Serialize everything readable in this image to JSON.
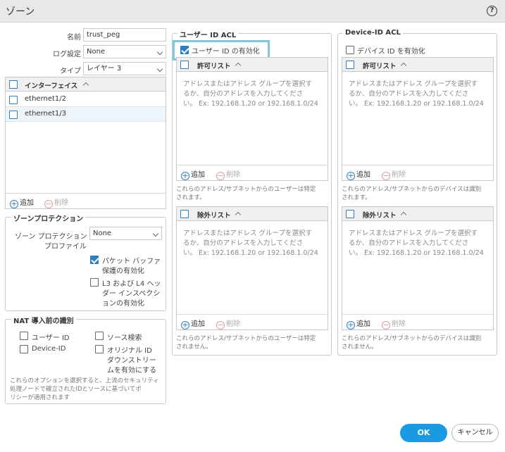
{
  "dialog": {
    "title": "ゾーン",
    "help": "?"
  },
  "form": {
    "name_label": "名前",
    "name_value": "trust_peg",
    "log_label": "ログ設定",
    "log_value": "None",
    "type_label": "タイプ",
    "type_value": "レイヤー 3"
  },
  "interfaces": {
    "header": "インターフェイス",
    "rows": [
      "ethernet1/2",
      "ethernet1/3"
    ],
    "add": "追加",
    "delete": "削除"
  },
  "zone_protection": {
    "legend": "ゾーンプロテクション",
    "profile_label_1": "ゾーン プロテクション",
    "profile_label_2": "プロファイル",
    "profile_value": "None",
    "packet_buffer_1": "パケット バッファ",
    "packet_buffer_2": "保護の有効化",
    "l3l4_1": "L3 および L4 ヘッ",
    "l3l4_2": "ダー インスペクシ",
    "l3l4_3": "ョンの有効化"
  },
  "nat": {
    "legend": "NAT 導入前の識別",
    "user_id": "ユーザー ID",
    "source_lookup": "ソース検索",
    "device_id": "Device-ID",
    "orig_id_1": "オリジナル ID",
    "orig_id_2": "ダウンストリー",
    "orig_id_3": "ムを有効にする",
    "note_1": "これらのオプションを選択すると、上流のセキュリティ",
    "note_2": "処理ノードで確立されたIDとソースに基づいてポ",
    "note_3": "リシーが適用されます"
  },
  "user_acl": {
    "legend": "ユーザー ID ACL",
    "enable": "ユーザー ID の有効化",
    "include_header": "許可リスト",
    "include_placeholder_1": "アドレスまたはアドレス グループを選択す",
    "include_placeholder_2": "るか、自分のアドレスを入力してくださ",
    "include_placeholder_3": "い。 Ex: 192.168.1.20 or 192.168.1.0/24",
    "include_note_1": "これらのアドレス/サブネットからのユーザーは特定",
    "include_note_2": "されます。",
    "exclude_header": "除外リスト",
    "exclude_note_1": "これらのアドレス/サブネットからのユーザーは特定",
    "exclude_note_2": "されません。",
    "add": "追加",
    "delete": "削除"
  },
  "device_acl": {
    "legend": "Device-ID ACL",
    "enable": "デバイス ID を有効化",
    "include_header": "許可リスト",
    "include_note_1": "これらのアドレス/サブネットからのデバイスは識別",
    "include_note_2": "されます。",
    "exclude_header": "除外リスト",
    "exclude_note_1": "これらのアドレス/サブネットからのデバイスは識別",
    "exclude_note_2": "されません。",
    "add": "追加",
    "delete": "削除"
  },
  "buttons": {
    "ok": "OK",
    "cancel": "キャンセル"
  },
  "colors": {
    "accent": "#1a9ae0",
    "checkbox": "#2d7fc1",
    "highlight": "#7ec9e0"
  }
}
